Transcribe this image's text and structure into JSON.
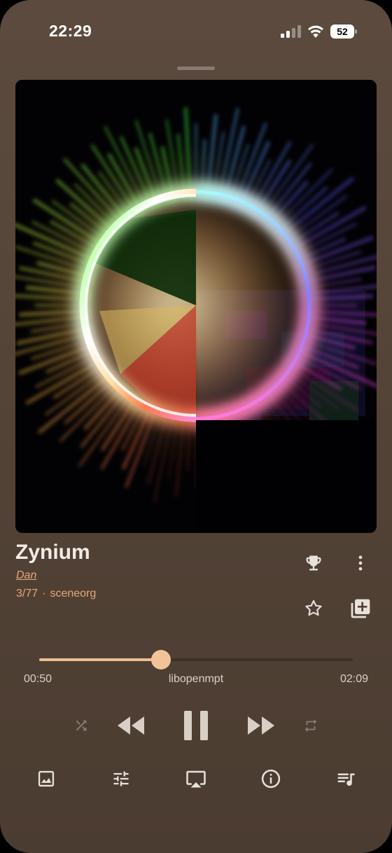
{
  "status_bar": {
    "time": "22:29",
    "battery": "52"
  },
  "track": {
    "title": "Zynium",
    "artist": "Dan",
    "position": "3/77",
    "separator": "·",
    "source": "sceneorg"
  },
  "playback": {
    "elapsed": "00:50",
    "total": "02:09",
    "decoder": "libopenmpt",
    "progress_fraction": 0.389
  },
  "icons": {
    "trophy": "trophy-icon",
    "more": "more-vertical-icon",
    "favorite": "star-outline-icon",
    "add_to_playlist": "library-add-icon",
    "shuffle": "shuffle-icon",
    "previous": "rewind-icon",
    "play_pause": "pause-icon",
    "next": "fast-forward-icon",
    "repeat": "repeat-icon",
    "artwork": "image-icon",
    "equalizer": "tune-icon",
    "airplay": "airplay-icon",
    "info": "info-icon",
    "queue": "queue-music-icon"
  },
  "colors": {
    "background": "#54443a",
    "accent": "#e7a77a",
    "slider": "#f2c39a",
    "icon": "#e8e2dc"
  }
}
